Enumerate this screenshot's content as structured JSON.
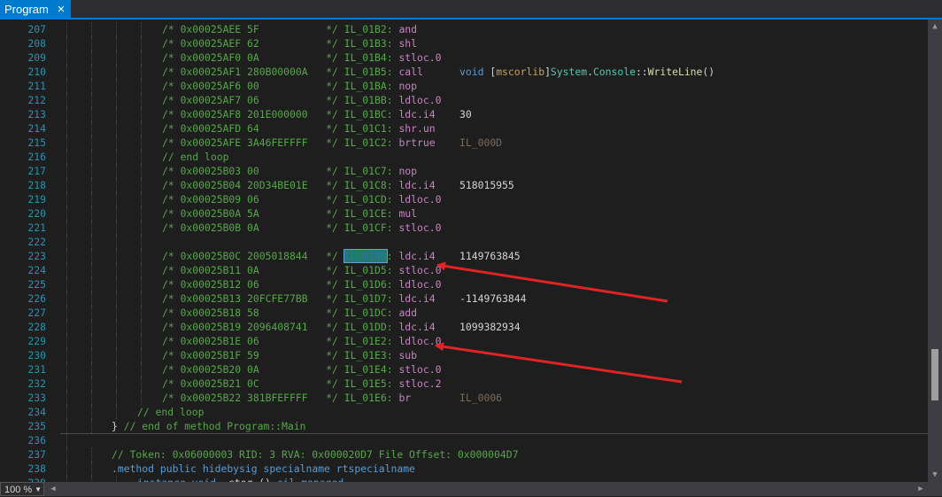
{
  "tab": {
    "title": "Program",
    "close_icon": "×"
  },
  "zoom": {
    "value": "100 %"
  },
  "colors": {
    "accent": "#007acc",
    "arrow": "#e02424"
  },
  "lines": [
    {
      "n": "207",
      "indent": 4,
      "segs": [
        [
          "c",
          "/* 0x00025AEE 5F           */ IL_01B2: "
        ],
        [
          "opc",
          "and"
        ]
      ]
    },
    {
      "n": "208",
      "indent": 4,
      "segs": [
        [
          "c",
          "/* 0x00025AEF 62           */ IL_01B3: "
        ],
        [
          "opc",
          "shl"
        ]
      ]
    },
    {
      "n": "209",
      "indent": 4,
      "segs": [
        [
          "c",
          "/* 0x00025AF0 0A           */ IL_01B4: "
        ],
        [
          "opc",
          "stloc.0"
        ]
      ]
    },
    {
      "n": "210",
      "indent": 4,
      "segs": [
        [
          "c",
          "/* 0x00025AF1 280B00000A   */ IL_01B5: "
        ],
        [
          "opc",
          "call      "
        ],
        [
          "kw",
          "void "
        ],
        [
          "plain",
          "["
        ],
        [
          "ns",
          "mscorlib"
        ],
        [
          "plain",
          "]"
        ],
        [
          "type",
          "System"
        ],
        [
          "plain",
          "."
        ],
        [
          "type",
          "Console"
        ],
        [
          "plain",
          "::"
        ],
        [
          "method",
          "WriteLine"
        ],
        [
          "plain",
          "()"
        ]
      ]
    },
    {
      "n": "211",
      "indent": 4,
      "segs": [
        [
          "c",
          "/* 0x00025AF6 00           */ IL_01BA: "
        ],
        [
          "opc",
          "nop"
        ]
      ]
    },
    {
      "n": "212",
      "indent": 4,
      "segs": [
        [
          "c",
          "/* 0x00025AF7 06           */ IL_01BB: "
        ],
        [
          "opc",
          "ldloc.0"
        ]
      ]
    },
    {
      "n": "213",
      "indent": 4,
      "segs": [
        [
          "c",
          "/* 0x00025AF8 201E000000   */ IL_01BC: "
        ],
        [
          "opc",
          "ldc.i4    "
        ],
        [
          "num",
          "30"
        ]
      ]
    },
    {
      "n": "214",
      "indent": 4,
      "segs": [
        [
          "c",
          "/* 0x00025AFD 64           */ IL_01C1: "
        ],
        [
          "opc",
          "shr.un"
        ]
      ]
    },
    {
      "n": "215",
      "indent": 4,
      "segs": [
        [
          "c",
          "/* 0x00025AFE 3A46FEFFFF   */ IL_01C2: "
        ],
        [
          "opc",
          "brtrue    "
        ],
        [
          "lbl",
          "IL_000D"
        ]
      ]
    },
    {
      "n": "216",
      "indent": 3,
      "segs": [
        [
          "c",
          "// end loop"
        ]
      ]
    },
    {
      "n": "217",
      "indent": 3,
      "segs": [
        [
          "c",
          "/* 0x00025B03 00           */ IL_01C7: "
        ],
        [
          "opc",
          "nop"
        ]
      ]
    },
    {
      "n": "218",
      "indent": 3,
      "segs": [
        [
          "c",
          "/* 0x00025B04 20D34BE01E   */ IL_01C8: "
        ],
        [
          "opc",
          "ldc.i4    "
        ],
        [
          "num",
          "518015955"
        ]
      ]
    },
    {
      "n": "219",
      "indent": 3,
      "segs": [
        [
          "c",
          "/* 0x00025B09 06           */ IL_01CD: "
        ],
        [
          "opc",
          "ldloc.0"
        ]
      ]
    },
    {
      "n": "220",
      "indent": 3,
      "segs": [
        [
          "c",
          "/* 0x00025B0A 5A           */ IL_01CE: "
        ],
        [
          "opc",
          "mul"
        ]
      ]
    },
    {
      "n": "221",
      "indent": 3,
      "segs": [
        [
          "c",
          "/* 0x00025B0B 0A           */ IL_01CF: "
        ],
        [
          "opc",
          "stloc.0"
        ]
      ]
    },
    {
      "n": "222",
      "indent": 3,
      "segs": []
    },
    {
      "n": "223",
      "indent": 3,
      "segs": [
        [
          "c",
          "/* 0x00025B0C 2005018844   */ "
        ],
        [
          "sel",
          "IL_01D0"
        ],
        [
          "c",
          ": "
        ],
        [
          "opc",
          "ldc.i4    "
        ],
        [
          "num",
          "1149763845"
        ]
      ]
    },
    {
      "n": "224",
      "indent": 3,
      "segs": [
        [
          "c",
          "/* 0x00025B11 0A           */ IL_01D5: "
        ],
        [
          "opc",
          "stloc.0"
        ]
      ]
    },
    {
      "n": "225",
      "indent": 3,
      "segs": [
        [
          "c",
          "/* 0x00025B12 06           */ IL_01D6: "
        ],
        [
          "opc",
          "ldloc.0"
        ]
      ]
    },
    {
      "n": "226",
      "indent": 3,
      "segs": [
        [
          "c",
          "/* 0x00025B13 20FCFE77BB   */ IL_01D7: "
        ],
        [
          "opc",
          "ldc.i4    "
        ],
        [
          "num",
          "-1149763844"
        ]
      ]
    },
    {
      "n": "227",
      "indent": 3,
      "segs": [
        [
          "c",
          "/* 0x00025B18 58           */ IL_01DC: "
        ],
        [
          "opc",
          "add"
        ]
      ]
    },
    {
      "n": "228",
      "indent": 3,
      "segs": [
        [
          "c",
          "/* 0x00025B19 2096408741   */ IL_01DD: "
        ],
        [
          "opc",
          "ldc.i4    "
        ],
        [
          "num",
          "1099382934"
        ]
      ]
    },
    {
      "n": "229",
      "indent": 3,
      "segs": [
        [
          "c",
          "/* 0x00025B1E 06           */ IL_01E2: "
        ],
        [
          "opc",
          "ldloc.0"
        ]
      ]
    },
    {
      "n": "230",
      "indent": 3,
      "segs": [
        [
          "c",
          "/* 0x00025B1F 59           */ IL_01E3: "
        ],
        [
          "opc",
          "sub"
        ]
      ]
    },
    {
      "n": "231",
      "indent": 3,
      "segs": [
        [
          "c",
          "/* 0x00025B20 0A           */ IL_01E4: "
        ],
        [
          "opc",
          "stloc.0"
        ]
      ]
    },
    {
      "n": "232",
      "indent": 3,
      "segs": [
        [
          "c",
          "/* 0x00025B21 0C           */ IL_01E5: "
        ],
        [
          "opc",
          "stloc.2"
        ]
      ]
    },
    {
      "n": "233",
      "indent": 3,
      "segs": [
        [
          "c",
          "/* 0x00025B22 381BFEFFFF   */ IL_01E6: "
        ],
        [
          "opc",
          "br        "
        ],
        [
          "lbl",
          "IL_0006"
        ]
      ]
    },
    {
      "n": "234",
      "indent": 2,
      "segs": [
        [
          "c",
          "// end loop"
        ]
      ]
    },
    {
      "n": "235",
      "indent": 1,
      "segs": [
        [
          "plain",
          "} "
        ],
        [
          "c",
          "// end of method Program::Main"
        ]
      ]
    },
    {
      "n": "236",
      "indent": 0,
      "segs": []
    },
    {
      "n": "237",
      "indent": 1,
      "segs": [
        [
          "c",
          "// Token: 0x06000003 RID: 3 RVA: 0x000020D7 File Offset: 0x000004D7"
        ]
      ]
    },
    {
      "n": "238",
      "indent": 1,
      "segs": [
        [
          "kw",
          ".method "
        ],
        [
          "kw",
          "public "
        ],
        [
          "kw",
          "hidebysig "
        ],
        [
          "kw",
          "specialname "
        ],
        [
          "kw",
          "rtspecialname"
        ]
      ]
    },
    {
      "n": "239",
      "indent": 2,
      "segs": [
        [
          "kw",
          "instance "
        ],
        [
          "kw",
          "void "
        ],
        [
          "plain",
          ".ctor () "
        ],
        [
          "kw",
          "cil "
        ],
        [
          "kw",
          "managed"
        ]
      ]
    }
  ]
}
